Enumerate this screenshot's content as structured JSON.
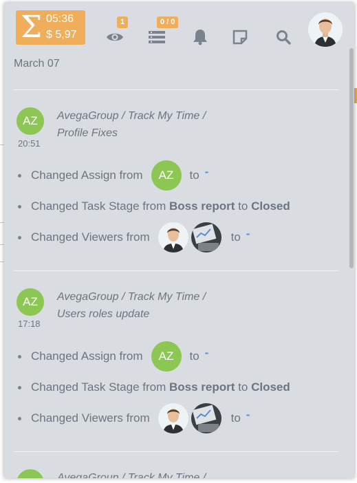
{
  "timer": {
    "time": "05:36",
    "money": "$ 5,97"
  },
  "header": {
    "watch_badge": "1",
    "tasks_badge": "0 / 0",
    "icons": [
      "sigma-icon",
      "eye-icon",
      "list-icon",
      "bell-icon",
      "note-icon",
      "search-icon",
      "avatar"
    ]
  },
  "feed": {
    "date": "March 07",
    "entries": [
      {
        "initials": "AZ",
        "time": "20:51",
        "path_line1": "AvegaGroup / Track My Time /",
        "path_line2": "Profile Fixes",
        "changes": [
          {
            "prefix": "Changed Assign from",
            "to_label": "to",
            "to_value": "-"
          },
          {
            "prefix": "Changed Task Stage from",
            "from": "Boss report",
            "to_label": "to",
            "to_value": "Closed"
          },
          {
            "prefix": "Changed Viewers from",
            "to_label": "to",
            "to_value": "-"
          }
        ]
      },
      {
        "initials": "AZ",
        "time": "17:18",
        "path_line1": "AvegaGroup / Track My Time /",
        "path_line2": "Users roles update",
        "changes": [
          {
            "prefix": "Changed Assign from",
            "to_label": "to",
            "to_value": "-"
          },
          {
            "prefix": "Changed Task Stage from",
            "from": "Boss report",
            "to_label": "to",
            "to_value": "Closed"
          },
          {
            "prefix": "Changed Viewers from",
            "to_label": "to",
            "to_value": "-"
          }
        ]
      },
      {
        "initials": "",
        "path_line1": "AvegaGroup / Track My Time /"
      }
    ]
  },
  "colors": {
    "accent": "#f0ad5a",
    "avatar_green": "#8cc653",
    "panel_bg": "#d9dde1",
    "link_blue": "#5a8bd6"
  }
}
